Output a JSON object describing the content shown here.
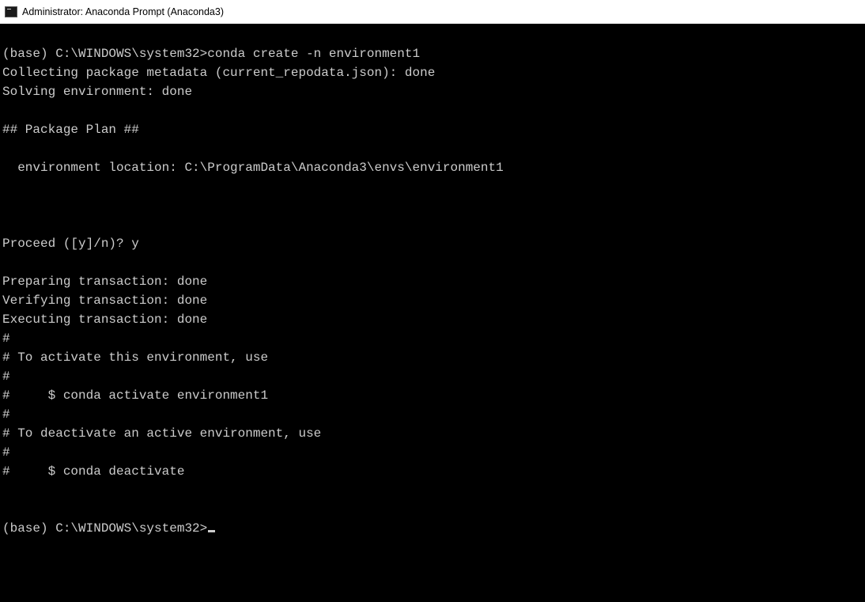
{
  "window": {
    "title": "Administrator: Anaconda Prompt (Anaconda3)"
  },
  "terminal": {
    "lines": [
      "",
      "(base) C:\\WINDOWS\\system32>conda create -n environment1",
      "Collecting package metadata (current_repodata.json): done",
      "Solving environment: done",
      "",
      "## Package Plan ##",
      "",
      "  environment location: C:\\ProgramData\\Anaconda3\\envs\\environment1",
      "",
      "",
      "",
      "Proceed ([y]/n)? y",
      "",
      "Preparing transaction: done",
      "Verifying transaction: done",
      "Executing transaction: done",
      "#",
      "# To activate this environment, use",
      "#",
      "#     $ conda activate environment1",
      "#",
      "# To deactivate an active environment, use",
      "#",
      "#     $ conda deactivate",
      "",
      ""
    ],
    "prompt": "(base) C:\\WINDOWS\\system32>"
  }
}
